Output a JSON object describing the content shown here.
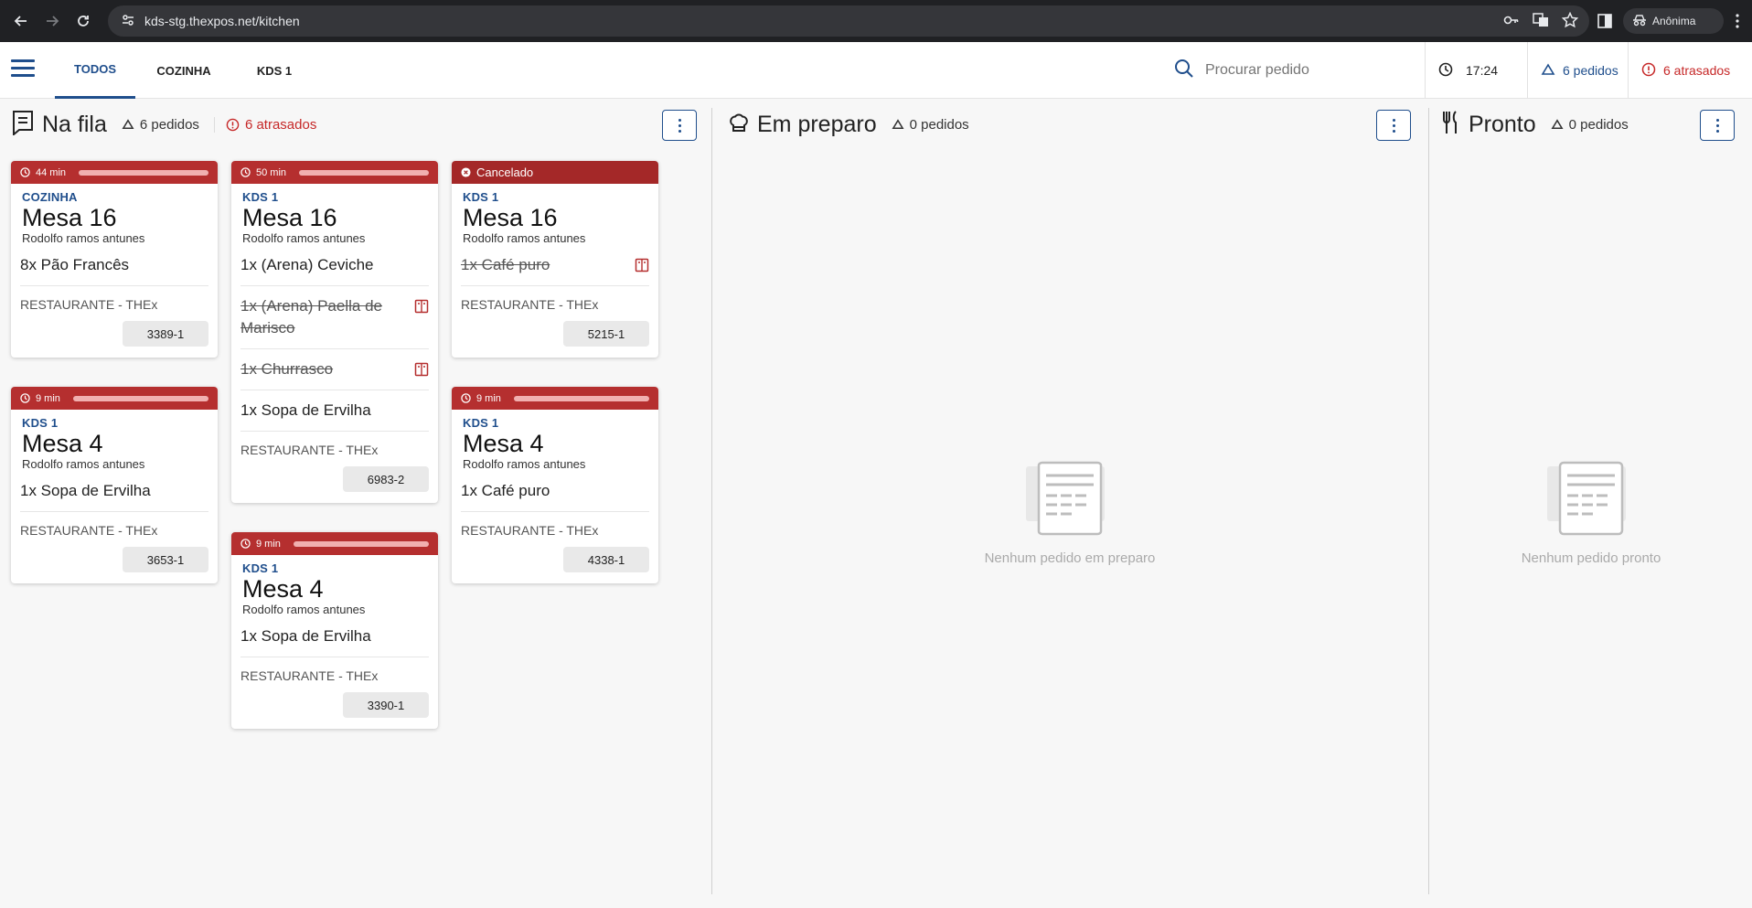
{
  "browser": {
    "url": "kds-stg.thexpos.net/kitchen",
    "profile_label": "Anônima"
  },
  "app": {
    "tabs": [
      {
        "label": "TODOS",
        "active": true
      },
      {
        "label": "COZINHA",
        "active": false
      },
      {
        "label": "KDS 1",
        "active": false
      }
    ],
    "search_placeholder": "Procurar pedido",
    "time": "17:24",
    "total_orders": "6 pedidos",
    "total_late": "6 atrasados"
  },
  "columns": {
    "queue": {
      "title": "Na fila",
      "count": "6 pedidos",
      "late": "6 atrasados"
    },
    "preparing": {
      "title": "Em preparo",
      "count": "0 pedidos",
      "empty_text": "Nenhum pedido em preparo"
    },
    "ready": {
      "title": "Pronto",
      "count": "0 pedidos",
      "empty_text": "Nenhum pedido pronto"
    }
  },
  "orders": [
    {
      "timer": "44 min",
      "progress": 1.0,
      "sector": "COZINHA",
      "table": "Mesa 16",
      "customer": "Rodolfo ramos antunes",
      "items": [
        {
          "text": "8x Pão Francês",
          "cancelled": false
        }
      ],
      "restaurant": "RESTAURANTE - THEx",
      "code": "3389-1"
    },
    {
      "timer": "9 min",
      "progress": 1.0,
      "sector": "KDS 1",
      "table": "Mesa 4",
      "customer": "Rodolfo ramos antunes",
      "items": [
        {
          "text": "1x Sopa de Ervilha",
          "cancelled": false
        }
      ],
      "restaurant": "RESTAURANTE - THEx",
      "code": "3653-1"
    },
    {
      "timer": "50 min",
      "progress": 1.0,
      "sector": "KDS 1",
      "table": "Mesa 16",
      "customer": "Rodolfo ramos antunes",
      "items": [
        {
          "text": "1x (Arena) Ceviche",
          "cancelled": false
        },
        {
          "text": "1x (Arena) Paella de Marisco",
          "cancelled": true
        },
        {
          "text": "1x Churrasco",
          "cancelled": true
        },
        {
          "text": "1x Sopa de Ervilha",
          "cancelled": false
        }
      ],
      "restaurant": "RESTAURANTE - THEx",
      "code": "6983-2"
    },
    {
      "timer": "9 min",
      "progress": 1.0,
      "sector": "KDS 1",
      "table": "Mesa 4",
      "customer": "Rodolfo ramos antunes",
      "items": [
        {
          "text": "1x Sopa de Ervilha",
          "cancelled": false
        }
      ],
      "restaurant": "RESTAURANTE - THEx",
      "code": "3390-1"
    },
    {
      "status": "Cancelado",
      "sector": "KDS 1",
      "table": "Mesa 16",
      "customer": "Rodolfo ramos antunes",
      "items": [
        {
          "text": "1x Café puro",
          "cancelled": true
        }
      ],
      "restaurant": "RESTAURANTE - THEx",
      "code": "5215-1"
    },
    {
      "timer": "9 min",
      "progress": 1.0,
      "sector": "KDS 1",
      "table": "Mesa 4",
      "customer": "Rodolfo ramos antunes",
      "items": [
        {
          "text": "1x Café puro",
          "cancelled": false
        }
      ],
      "restaurant": "RESTAURANTE - THEx",
      "code": "4338-1"
    }
  ],
  "colors": {
    "accent": "#1f4e8c",
    "late": "#c62828",
    "timer_bar": "#b52f2f"
  },
  "icons": [
    "back-icon",
    "forward-icon",
    "reload-icon",
    "site-info-icon",
    "key-icon",
    "translate-icon",
    "star-icon",
    "sidebar-icon",
    "incognito-icon",
    "more-vert-icon",
    "search-icon",
    "clock-icon",
    "triangle-icon",
    "alert-circle-icon",
    "receipt-icon",
    "chef-hat-icon",
    "utensils-icon",
    "menu-book-icon",
    "cancel-circle-icon",
    "empty-orders-icon"
  ]
}
